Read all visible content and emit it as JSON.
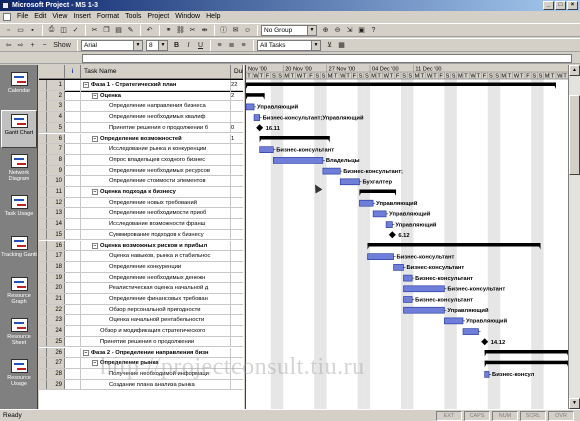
{
  "window": {
    "title": "Microsoft Project - MS 1-3"
  },
  "menu": [
    "File",
    "Edit",
    "View",
    "Insert",
    "Format",
    "Tools",
    "Project",
    "Window",
    "Help"
  ],
  "toolbar1": {
    "group_value": "No Group"
  },
  "toolbar2": {
    "show_label": "Show",
    "font_value": "Arial",
    "size_value": "8",
    "filter_value": "All Tasks"
  },
  "viewbar": [
    {
      "label": "Calendar",
      "active": false
    },
    {
      "label": "Gantt Chart",
      "active": true
    },
    {
      "label": "Network Diagram",
      "active": false
    },
    {
      "label": "Task Usage",
      "active": false
    },
    {
      "label": "Tracking Gantt",
      "active": false
    },
    {
      "label": "Resource Graph",
      "active": false
    },
    {
      "label": "Resource Sheet",
      "active": false
    },
    {
      "label": "Resource Usage",
      "active": false
    }
  ],
  "grid": {
    "headers": {
      "indicator": "i",
      "task_name": "Task Name",
      "duration": "Dur"
    },
    "rows": [
      {
        "id": "1",
        "name": "Фаза 1 - Стратегический план",
        "dur": "22",
        "summary": true,
        "indent": 0,
        "toggle": "−"
      },
      {
        "id": "2",
        "name": "Оценка",
        "dur": "2",
        "summary": true,
        "indent": 1,
        "toggle": "−"
      },
      {
        "id": "3",
        "name": "Определение направления бизнеса",
        "dur": "",
        "summary": false,
        "indent": 2,
        "toggle": ""
      },
      {
        "id": "4",
        "name": "Определение необходимых квалиф",
        "dur": "",
        "summary": false,
        "indent": 2,
        "toggle": ""
      },
      {
        "id": "5",
        "name": "Принятие решения о продолжении б",
        "dur": "0",
        "summary": false,
        "indent": 2,
        "toggle": ""
      },
      {
        "id": "6",
        "name": "Определение возможностей",
        "dur": "1",
        "summary": true,
        "indent": 1,
        "toggle": "−"
      },
      {
        "id": "7",
        "name": "Исследование рынка и конкуренции",
        "dur": "",
        "summary": false,
        "indent": 2,
        "toggle": ""
      },
      {
        "id": "8",
        "name": "Опрос владельцев сходного бизнес",
        "dur": "",
        "summary": false,
        "indent": 2,
        "toggle": ""
      },
      {
        "id": "9",
        "name": "Определение необходимых ресурсов",
        "dur": "",
        "summary": false,
        "indent": 2,
        "toggle": ""
      },
      {
        "id": "10",
        "name": "Определение стоимости элементов",
        "dur": "",
        "summary": false,
        "indent": 2,
        "toggle": ""
      },
      {
        "id": "11",
        "name": "Оценка подхода к бизнесу",
        "dur": "",
        "summary": true,
        "indent": 1,
        "toggle": "−"
      },
      {
        "id": "12",
        "name": "Определение новых требований",
        "dur": "",
        "summary": false,
        "indent": 2,
        "toggle": ""
      },
      {
        "id": "13",
        "name": "Определение необходимости приоб",
        "dur": "",
        "summary": false,
        "indent": 2,
        "toggle": ""
      },
      {
        "id": "14",
        "name": "Исследование возможности франш",
        "dur": "",
        "summary": false,
        "indent": 2,
        "toggle": ""
      },
      {
        "id": "15",
        "name": "Суммирование подходов к бизнесу",
        "dur": "",
        "summary": false,
        "indent": 2,
        "toggle": ""
      },
      {
        "id": "16",
        "name": "Оценка возможных рисков и прибыл",
        "dur": "",
        "summary": true,
        "indent": 1,
        "toggle": "−"
      },
      {
        "id": "17",
        "name": "Оценка навыков, рынка и стабильнос",
        "dur": "",
        "summary": false,
        "indent": 2,
        "toggle": ""
      },
      {
        "id": "18",
        "name": "Определение конкуренции",
        "dur": "",
        "summary": false,
        "indent": 2,
        "toggle": ""
      },
      {
        "id": "19",
        "name": "Определение необходимых денежн",
        "dur": "",
        "summary": false,
        "indent": 2,
        "toggle": ""
      },
      {
        "id": "20",
        "name": "Реалистическая оценка начальной д",
        "dur": "",
        "summary": false,
        "indent": 2,
        "toggle": ""
      },
      {
        "id": "21",
        "name": "Определение финансовых требован",
        "dur": "",
        "summary": false,
        "indent": 2,
        "toggle": ""
      },
      {
        "id": "22",
        "name": "Обзор персональной пригодности",
        "dur": "",
        "summary": false,
        "indent": 2,
        "toggle": ""
      },
      {
        "id": "23",
        "name": "Оценка начальной рентабельности",
        "dur": "",
        "summary": false,
        "indent": 2,
        "toggle": ""
      },
      {
        "id": "24",
        "name": "Обзор и модификация стратегического",
        "dur": "",
        "summary": false,
        "indent": 1,
        "toggle": ""
      },
      {
        "id": "25",
        "name": "Принятие решения о продолжении",
        "dur": "",
        "summary": false,
        "indent": 1,
        "toggle": ""
      },
      {
        "id": "26",
        "name": "Фаза 2 - Определение направления бизн",
        "dur": "",
        "summary": true,
        "indent": 0,
        "toggle": "−"
      },
      {
        "id": "27",
        "name": "Определение рынка",
        "dur": "",
        "summary": true,
        "indent": 1,
        "toggle": "−"
      },
      {
        "id": "28",
        "name": "Получение необходимой информаци",
        "dur": "",
        "summary": false,
        "indent": 2,
        "toggle": ""
      },
      {
        "id": "29",
        "name": "Создание плана анализа рынка",
        "dur": "",
        "summary": false,
        "indent": 2,
        "toggle": ""
      }
    ]
  },
  "gantt": {
    "weeks": [
      "Nov '00",
      "20 Nov '00",
      "27 Nov '00",
      "04 Dec '00",
      "11 Dec '00"
    ],
    "days": [
      "T",
      "W",
      "T",
      "F",
      "S",
      "S",
      "M",
      "T",
      "W",
      "T",
      "F",
      "S",
      "S",
      "M",
      "T",
      "W",
      "T",
      "F",
      "S",
      "S",
      "M",
      "T",
      "W",
      "T",
      "F",
      "S",
      "S",
      "M",
      "T",
      "W",
      "T",
      "F",
      "S",
      "S",
      "M",
      "T",
      "W",
      "T",
      "F",
      "S",
      "S",
      "M",
      "T",
      "W",
      "T",
      "F",
      "S",
      "S",
      "M",
      "T",
      "W",
      "T"
    ],
    "colors": {
      "bar": "#6f7fd9",
      "bar_border": "#1c2f9e",
      "summary": "#000000",
      "weekend": "#e6e6e6"
    },
    "tasks": [
      {
        "row": 1,
        "type": "summary",
        "start": 0,
        "end": 50,
        "label": ""
      },
      {
        "row": 2,
        "type": "summary",
        "start": 0,
        "end": 3,
        "label": ""
      },
      {
        "row": 3,
        "type": "bar",
        "start": 0,
        "end": 1.3,
        "label": "Управляющий"
      },
      {
        "row": 4,
        "type": "bar",
        "start": 1.3,
        "end": 2.2,
        "label": "Бизнес-консультант;Управляющий"
      },
      {
        "row": 5,
        "type": "milestone",
        "start": 2.2,
        "end": 2.2,
        "label": "16.11"
      },
      {
        "row": 6,
        "type": "summary",
        "start": 2.2,
        "end": 13.5,
        "label": ""
      },
      {
        "row": 7,
        "type": "bar",
        "start": 2.2,
        "end": 4.4,
        "label": "Бизнес-консультант"
      },
      {
        "row": 8,
        "type": "bar",
        "start": 4.4,
        "end": 12.4,
        "label": "Владельцы"
      },
      {
        "row": 9,
        "type": "bar",
        "start": 12.4,
        "end": 15.2,
        "label": "Бизнес-консультант;"
      },
      {
        "row": 10,
        "type": "bar",
        "start": 15.2,
        "end": 18.3,
        "label": "Бухгалтер"
      },
      {
        "row": 11,
        "type": "summary",
        "start": 18.3,
        "end": 24.2,
        "label": ""
      },
      {
        "row": 12,
        "type": "bar",
        "start": 18.3,
        "end": 20.5,
        "label": "Управляющий"
      },
      {
        "row": 13,
        "type": "bar",
        "start": 20.5,
        "end": 22.6,
        "label": "Управляющий"
      },
      {
        "row": 14,
        "type": "bar",
        "start": 22.6,
        "end": 23.6,
        "label": "Управляющий"
      },
      {
        "row": 15,
        "type": "milestone",
        "start": 23.6,
        "end": 23.6,
        "label": "6.12"
      },
      {
        "row": 16,
        "type": "summary",
        "start": 19.6,
        "end": 47.5,
        "label": ""
      },
      {
        "row": 17,
        "type": "bar",
        "start": 19.6,
        "end": 23.8,
        "label": "Бизнес-консультант"
      },
      {
        "row": 18,
        "type": "bar",
        "start": 23.8,
        "end": 25.4,
        "label": "Бизнес-консультант"
      },
      {
        "row": 19,
        "type": "bar",
        "start": 25.4,
        "end": 26.8,
        "label": "Бизнес-консультант"
      },
      {
        "row": 20,
        "type": "bar",
        "start": 25.4,
        "end": 32.0,
        "label": "Бизнес-консультант"
      },
      {
        "row": 21,
        "type": "bar",
        "start": 25.4,
        "end": 26.8,
        "label": "Бизнес-консультант"
      },
      {
        "row": 22,
        "type": "bar",
        "start": 25.4,
        "end": 32.0,
        "label": "Управляющий"
      },
      {
        "row": 23,
        "type": "bar",
        "start": 32.0,
        "end": 35.0,
        "label": "Управляющий"
      },
      {
        "row": 24,
        "type": "bar",
        "start": 35.0,
        "end": 37.5,
        "label": ""
      },
      {
        "row": 25,
        "type": "milestone",
        "start": 38.5,
        "end": 38.5,
        "label": "14.12"
      },
      {
        "row": 26,
        "type": "summary",
        "start": 38.5,
        "end": 52,
        "label": ""
      },
      {
        "row": 27,
        "type": "summary",
        "start": 38.5,
        "end": 52,
        "label": ""
      },
      {
        "row": 28,
        "type": "bar",
        "start": 38.5,
        "end": 39.2,
        "label": "Бизнес-консул"
      }
    ]
  },
  "watermark": "http://projectconsult.tiu.ru",
  "status": {
    "ready": "Ready",
    "indicators": [
      "EXT",
      "CAPS",
      "NUM",
      "SCRL",
      "OVR"
    ]
  }
}
